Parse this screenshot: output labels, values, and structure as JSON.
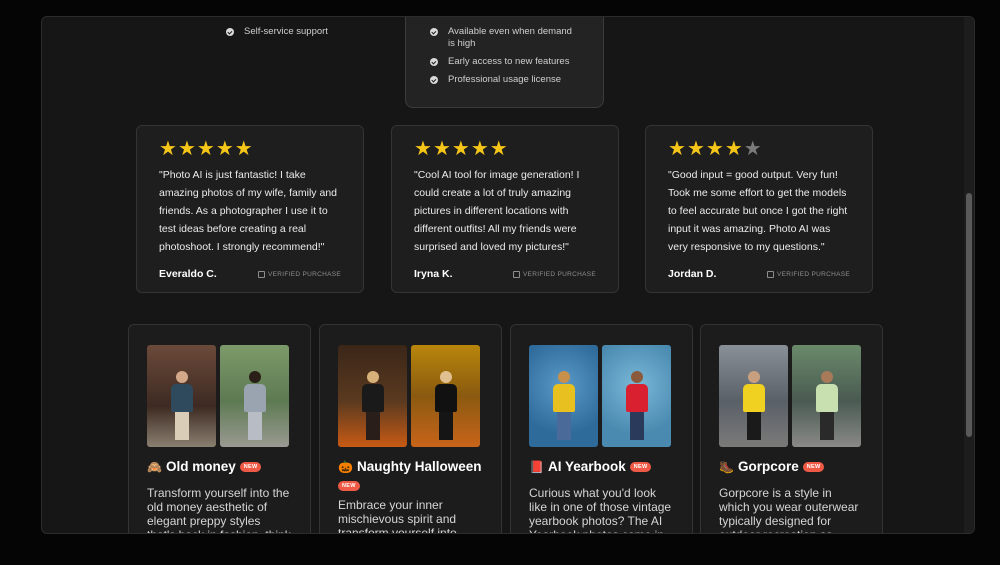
{
  "plan_left": {
    "features": [
      "Self-service support"
    ]
  },
  "plan_box": {
    "features": [
      "Available even when demand is high",
      "Early access to new features",
      "Professional usage license"
    ]
  },
  "reviews": [
    {
      "stars": 5,
      "text": "\"Photo AI is just fantastic! I take amazing photos of my wife, family and friends. As a photographer I use it to test ideas before creating a real photoshoot. I strongly recommend!\"",
      "name": "Everaldo C.",
      "verified": "VERIFIED PURCHASE"
    },
    {
      "stars": 5,
      "text": "\"Cool AI tool for image generation! I could create a lot of truly amazing pictures in different locations with different outfits! All my friends were surprised and loved my pictures!\"",
      "name": "Iryna K.",
      "verified": "VERIFIED PURCHASE"
    },
    {
      "stars": 4,
      "text": "\"Good input = good output. Very fun! Took me some effort to get the models to feel accurate but once I got the right input it was amazing. Photo AI was very responsive to my questions.\"",
      "name": "Jordan D.",
      "verified": "VERIFIED PURCHASE"
    }
  ],
  "styles": [
    {
      "emoji": "🙈",
      "title": "Old money",
      "badge": "NEW",
      "desc": "Transform yourself into the old money aesthetic of elegant preppy styles that's back in fashion, think"
    },
    {
      "emoji": "🎃",
      "title": "Naughty Halloween",
      "badge": "NEW",
      "desc": "Embrace your inner mischievous spirit and transform yourself into"
    },
    {
      "emoji": "📕",
      "title": "AI Yearbook",
      "badge": "NEW",
      "desc": "Curious what you'd look like in one of those vintage yearbook photos? The AI Yearbook photos come in"
    },
    {
      "emoji": "🥾",
      "title": "Gorpcore",
      "badge": "NEW",
      "desc": "Gorpcore is a style in which you wear outerwear typically designed for outdoor recreation as"
    }
  ],
  "icons": {
    "check": "check-circle-icon",
    "star": "star-icon",
    "verified": "checkbox-icon"
  },
  "colors": {
    "star": "#f5c518",
    "badge": "#ef5a47",
    "background": "#161616"
  }
}
